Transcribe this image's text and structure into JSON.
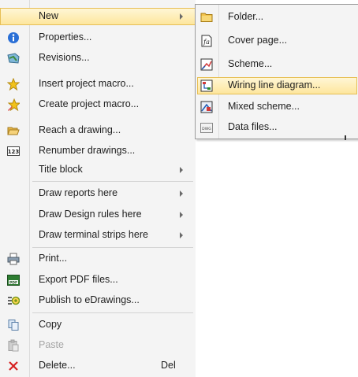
{
  "menu": {
    "items": [
      {
        "label": "New",
        "icon": "",
        "submenu": true,
        "highlight": true
      },
      {
        "label": "Properties...",
        "icon": "info-icon"
      },
      {
        "label": "Revisions...",
        "icon": "revisions-icon"
      },
      {
        "label": "Insert project macro...",
        "icon": "star-icon"
      },
      {
        "label": "Create project macro...",
        "icon": "star-pencil-icon"
      },
      {
        "label": "Reach a drawing...",
        "icon": "open-folder-icon"
      },
      {
        "label": "Renumber drawings...",
        "icon": "renumber-123-icon"
      },
      {
        "label": "Title block",
        "icon": "",
        "submenu": true
      },
      {
        "label": "Draw reports here",
        "icon": "",
        "submenu": true
      },
      {
        "label": "Draw Design rules here",
        "icon": "",
        "submenu": true
      },
      {
        "label": "Draw terminal strips here",
        "icon": "",
        "submenu": true
      },
      {
        "label": "Print...",
        "icon": "printer-icon"
      },
      {
        "label": "Export PDF files...",
        "icon": "pdf-icon"
      },
      {
        "label": "Publish to eDrawings...",
        "icon": "edrawings-icon"
      },
      {
        "label": "Copy",
        "icon": "copy-icon"
      },
      {
        "label": "Paste",
        "icon": "paste-icon",
        "disabled": true
      },
      {
        "label": "Delete...",
        "icon": "delete-x-icon",
        "shortcut": "Del"
      }
    ]
  },
  "submenu": {
    "items": [
      {
        "label": "Folder...",
        "icon": "folder-icon"
      },
      {
        "label": "Cover page...",
        "icon": "cover-page-icon"
      },
      {
        "label": "Scheme...",
        "icon": "scheme-icon"
      },
      {
        "label": "Wiring line diagram...",
        "icon": "wiring-diagram-icon",
        "highlight": true
      },
      {
        "label": "Mixed scheme...",
        "icon": "mixed-scheme-icon"
      },
      {
        "label": "Data files...",
        "icon": "dwg-file-icon",
        "icon_text": "DWG"
      }
    ]
  },
  "colors": {
    "highlight": "#fde59a",
    "highlight_border": "#e7bf55",
    "menu_bg": "#f4f4f4",
    "delete_red": "#d62020",
    "info_blue": "#2a6fd6",
    "star_gold": "#f2c21b"
  }
}
